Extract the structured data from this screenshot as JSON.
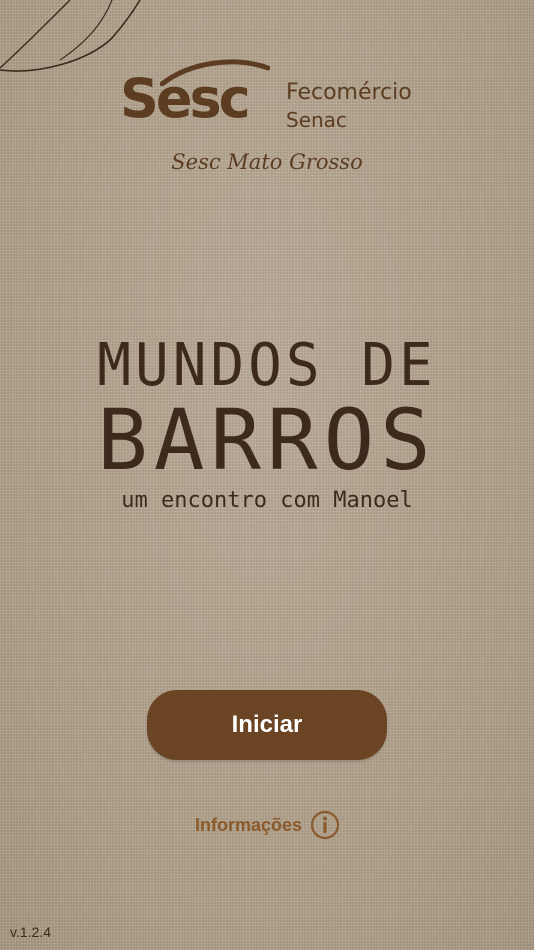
{
  "logo": {
    "brand": "Sesc",
    "partner_line1": "Fecomércio",
    "partner_line2": "Senac",
    "region": "Sesc Mato Grosso"
  },
  "title": {
    "line1": "MUNDOS DE",
    "line2": "BARROS",
    "tagline": "um encontro com Manoel"
  },
  "actions": {
    "start_label": "Iniciar",
    "info_label": "Informações"
  },
  "footer": {
    "version": "v.1.2.4"
  },
  "colors": {
    "background": "#b6a791",
    "brand_brown": "#5c3d22",
    "button": "#6b4424",
    "info_text": "#8a5a2c"
  },
  "icons": {
    "leaf": "leaf-outline-icon",
    "info": "info-circle-icon"
  }
}
